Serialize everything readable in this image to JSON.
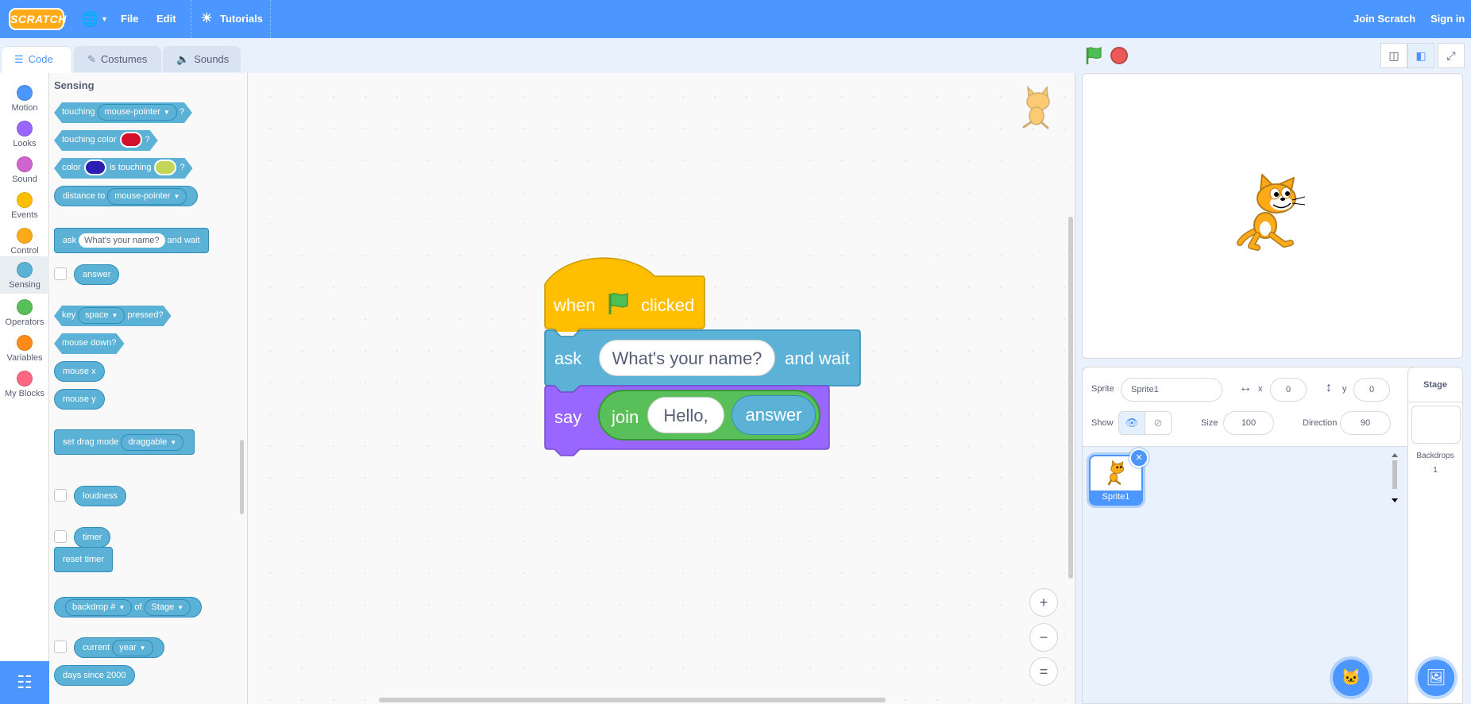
{
  "menu": {
    "logo_text": "SCRATCH",
    "file": "File",
    "edit": "Edit",
    "tutorials": "Tutorials",
    "join": "Join Scratch",
    "sign_in": "Sign in"
  },
  "tabs": {
    "code": "Code",
    "costumes": "Costumes",
    "sounds": "Sounds"
  },
  "categories": [
    {
      "label": "Motion",
      "color": "#4c97ff"
    },
    {
      "label": "Looks",
      "color": "#9966ff"
    },
    {
      "label": "Sound",
      "color": "#cf63cf"
    },
    {
      "label": "Events",
      "color": "#ffbf00"
    },
    {
      "label": "Control",
      "color": "#ffab19"
    },
    {
      "label": "Sensing",
      "color": "#5cb1d6"
    },
    {
      "label": "Operators",
      "color": "#59c059"
    },
    {
      "label": "Variables",
      "color": "#ff8c1a"
    },
    {
      "label": "My Blocks",
      "color": "#ff6680"
    }
  ],
  "flyout": {
    "title": "Sensing",
    "touching": "touching",
    "mouse_pointer": "mouse-pointer",
    "qmark": "?",
    "touching_color": "touching color",
    "color": "color",
    "is_touching": "is touching",
    "distance_to": "distance to",
    "ask": "ask",
    "ask_default": "What's your name?",
    "and_wait": "and wait",
    "answer": "answer",
    "key": "key",
    "space": "space",
    "pressed": "pressed?",
    "mouse_down": "mouse down?",
    "mouse_x": "mouse x",
    "mouse_y": "mouse y",
    "set_drag_mode": "set drag mode",
    "draggable": "draggable",
    "loudness": "loudness",
    "timer": "timer",
    "reset_timer": "reset timer",
    "backdrop_num": "backdrop #",
    "of": "of",
    "stage": "Stage",
    "current": "current",
    "year": "year",
    "days_since": "days since 2000"
  },
  "script": {
    "when": "when",
    "clicked": "clicked",
    "ask": "ask",
    "ask_value": "What's your name?",
    "and_wait": "and wait",
    "say": "say",
    "join": "join",
    "hello": "Hello,",
    "answer": "answer"
  },
  "zoom": {
    "in": "+",
    "out": "−",
    "reset": "="
  },
  "sprite_info": {
    "sprite_label": "Sprite",
    "sprite_name": "Sprite1",
    "x_label": "x",
    "x_value": "0",
    "y_label": "y",
    "y_value": "0",
    "show_label": "Show",
    "size_label": "Size",
    "size_value": "100",
    "direction_label": "Direction",
    "direction_value": "90"
  },
  "sprites": [
    {
      "name": "Sprite1"
    }
  ],
  "stage_pane": {
    "title": "Stage",
    "backdrops_label": "Backdrops",
    "backdrops_count": "1"
  }
}
